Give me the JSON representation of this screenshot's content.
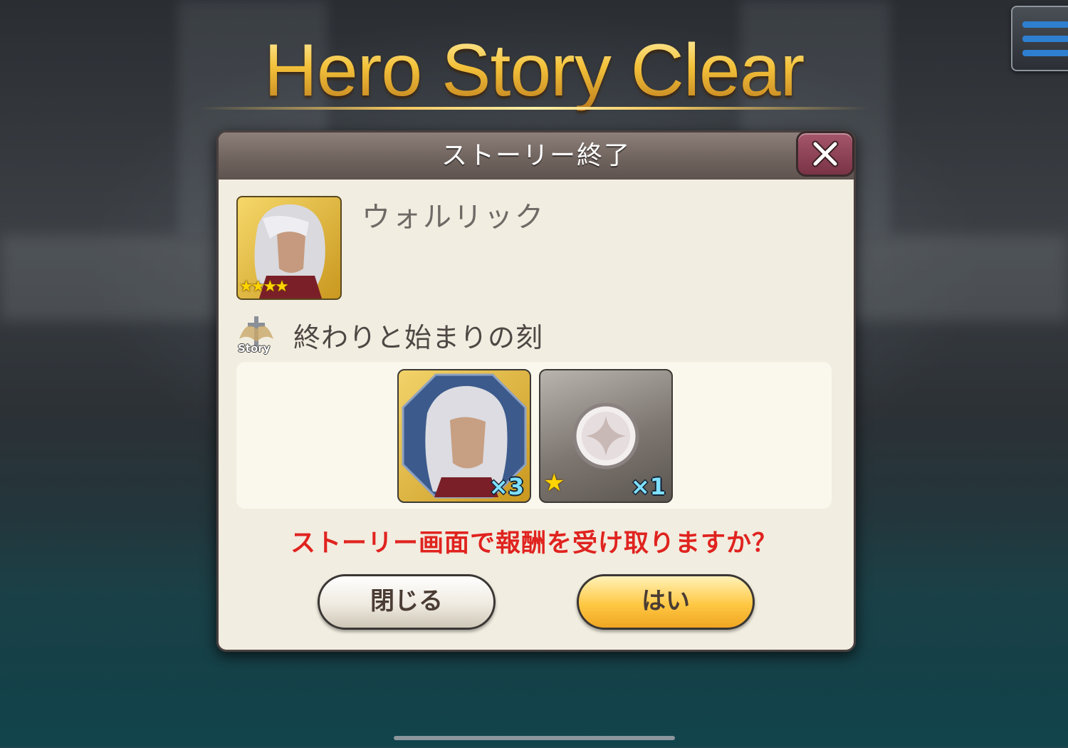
{
  "banner": {
    "title": "Hero Story Clear"
  },
  "dialog": {
    "title": "ストーリー終了",
    "hero": {
      "name": "ウォルリック",
      "rarity_stars": 4
    },
    "story": {
      "icon_label": "Story",
      "title": "終わりと始まりの刻"
    },
    "rewards": [
      {
        "icon": "hero-portrait-icon",
        "count": "×3"
      },
      {
        "icon": "medal-icon",
        "rarity_stars": 1,
        "count": "×1"
      }
    ],
    "prompt": "ストーリー画面で報酬を受け取りますか？",
    "buttons": {
      "close": "閉じる",
      "yes": "はい"
    }
  },
  "colors": {
    "title_gold": "#f5cf55",
    "header_bg": "#6e625d",
    "prompt_red": "#e0231f",
    "yes_button": "#ffc844",
    "close_x_button": "#8a3c50",
    "menu_blue": "#2f7fd0"
  }
}
